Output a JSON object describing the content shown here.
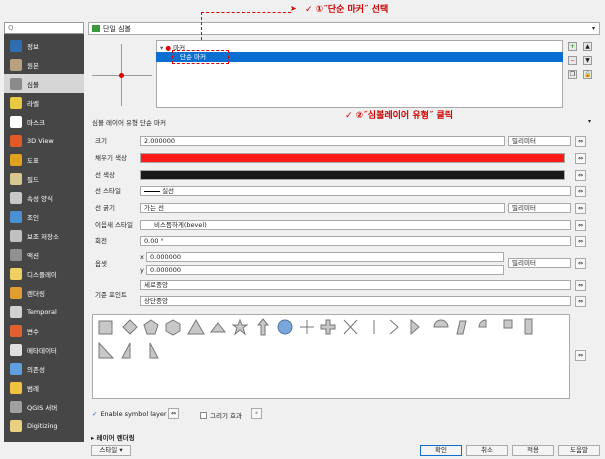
{
  "window": {
    "title": "단일 심볼"
  },
  "search": {
    "placeholder": "Q"
  },
  "sidebar": {
    "items": [
      {
        "label": "정보",
        "icon": "info-icon",
        "color": "#2f6fb1"
      },
      {
        "label": "원본",
        "icon": "source-icon",
        "color": "#b8a080"
      },
      {
        "label": "심볼",
        "icon": "brush-icon",
        "color": "#8a8a8a"
      },
      {
        "label": "라벨",
        "icon": "label-icon",
        "color": "#e8c840"
      },
      {
        "label": "마스크",
        "icon": "mask-icon",
        "color": "#ffffff"
      },
      {
        "label": "3D View",
        "icon": "cube-icon",
        "color": "#e05a2a"
      },
      {
        "label": "도표",
        "icon": "chart-icon",
        "color": "#e0a020"
      },
      {
        "label": "필드",
        "icon": "fields-icon",
        "color": "#d8c890"
      },
      {
        "label": "속성 양식",
        "icon": "form-icon",
        "color": "#c8c8c8"
      },
      {
        "label": "조인",
        "icon": "join-icon",
        "color": "#4b90d0"
      },
      {
        "label": "보조 저장소",
        "icon": "storage-icon",
        "color": "#c0c0c0"
      },
      {
        "label": "액션",
        "icon": "gear-icon",
        "color": "#909090"
      },
      {
        "label": "디스플레이",
        "icon": "display-icon",
        "color": "#f0d060"
      },
      {
        "label": "렌더링",
        "icon": "render-icon",
        "color": "#e0a030"
      },
      {
        "label": "Temporal",
        "icon": "clock-icon",
        "color": "#d0d0d0"
      },
      {
        "label": "변수",
        "icon": "variable-icon",
        "color": "#e06030"
      },
      {
        "label": "메타데이터",
        "icon": "metadata-icon",
        "color": "#e0e0e0"
      },
      {
        "label": "의존성",
        "icon": "dependency-icon",
        "color": "#60a0e0"
      },
      {
        "label": "범례",
        "icon": "legend-icon",
        "color": "#f0c040"
      },
      {
        "label": "QGIS 서버",
        "icon": "server-icon",
        "color": "#a0a0a0"
      },
      {
        "label": "Digitizing",
        "icon": "digitizing-icon",
        "color": "#e8d080"
      }
    ]
  },
  "tree": {
    "root": "마커",
    "child": "단순 마커"
  },
  "symbol_layer": {
    "label": "심볼 레이어 유형",
    "value": "단순 마커"
  },
  "props": {
    "size_label": "크기",
    "size_value": "2.000000",
    "size_unit": "밀리미터",
    "fill_label": "채우기 색상",
    "fill_color": "#ff1a1a",
    "stroke_color_label": "선 색상",
    "stroke_color": "#1a1a1a",
    "stroke_style_label": "선 스타일",
    "stroke_style_value": "실선",
    "stroke_width_label": "선 굵기",
    "stroke_width_value": "가는 선",
    "stroke_width_unit": "밀리미터",
    "join_label": "이음새 스타일",
    "join_value": "비스듬하게(bevel)",
    "rotation_label": "회전",
    "rotation_value": "0.00 °",
    "offset_label": "옵셋",
    "offset_x_label": "x",
    "offset_x": "0.000000",
    "offset_y_label": "y",
    "offset_y": "0.000000",
    "offset_unit": "밀리미터",
    "anchor_label": "기준 포인트",
    "anchor_v": "세로중앙",
    "anchor_h": "상단중앙"
  },
  "enable_label": "Enable symbol layer",
  "effects_label": "그리기 효과",
  "layer_render_label": "레이어 렌더링",
  "buttons": {
    "style": "스타일",
    "ok": "확인",
    "cancel": "취소",
    "apply": "적용",
    "help": "도움말"
  },
  "annotations": {
    "a1": "✓  ①˝단순 마커˝ 선택",
    "a2": "✓  ②˝심볼레이어 유형˝ 클릭",
    "color": "#cc0000"
  }
}
